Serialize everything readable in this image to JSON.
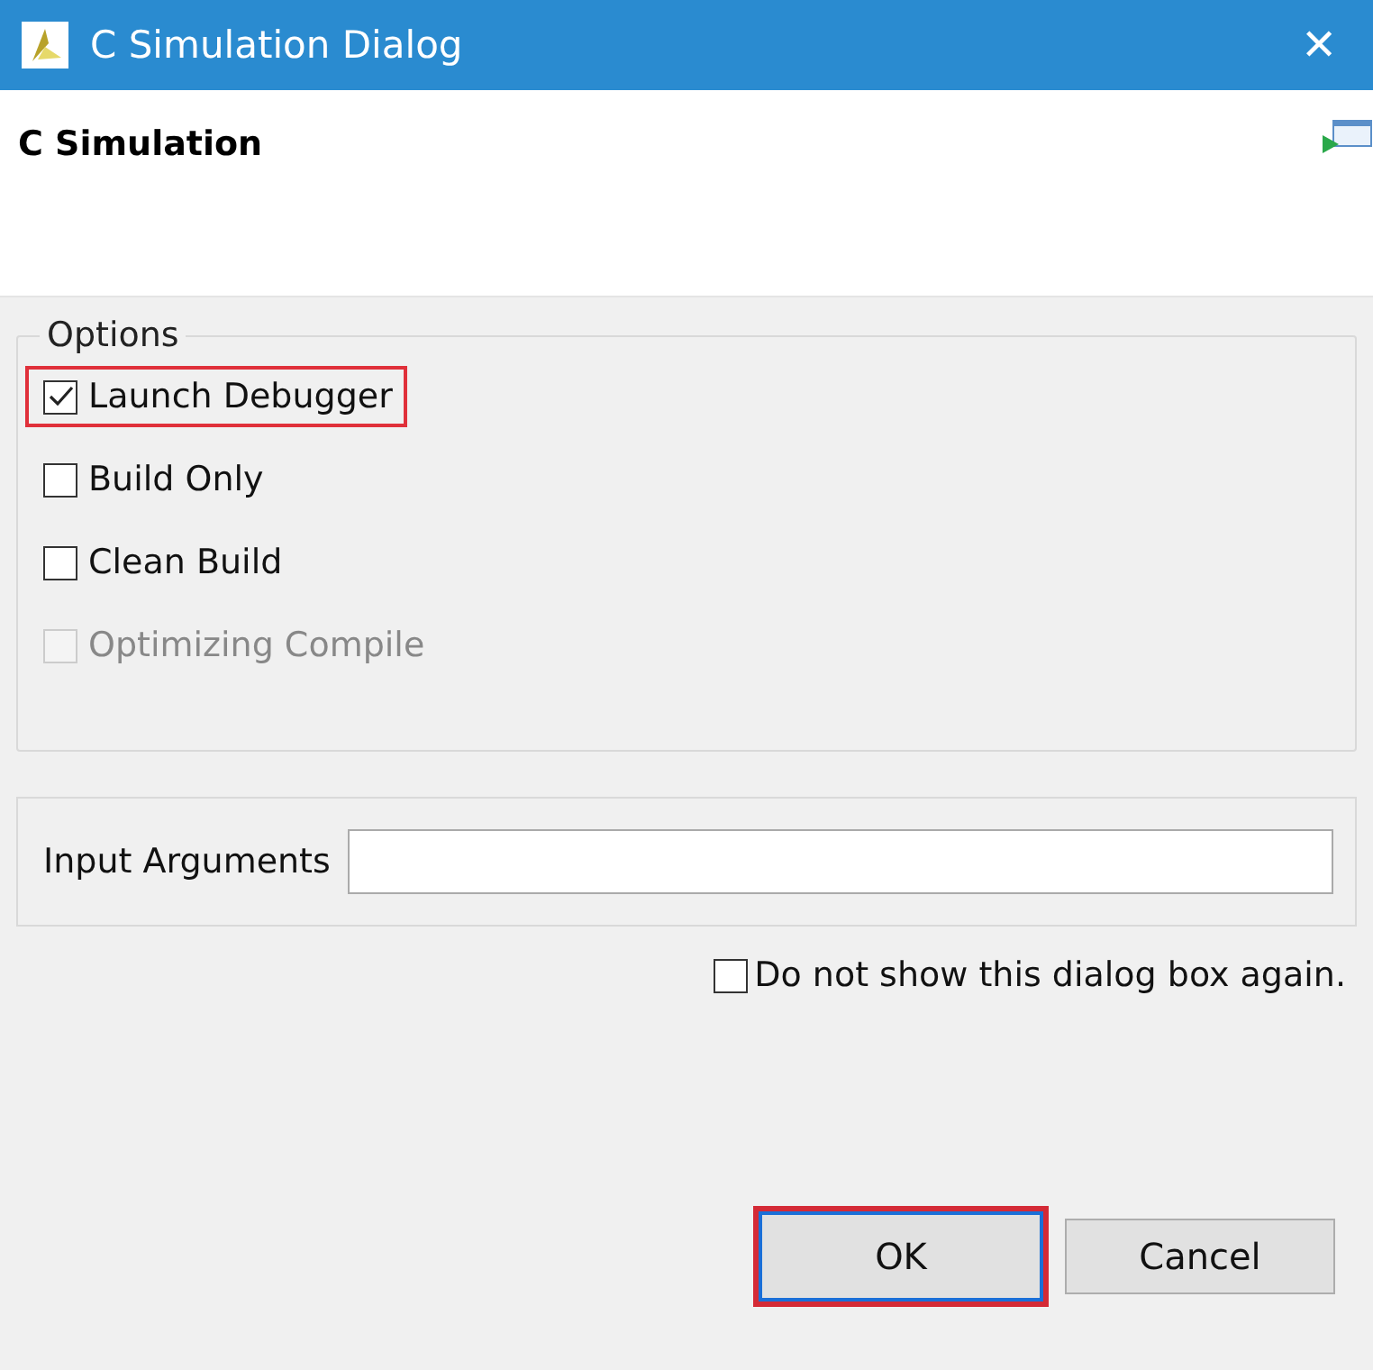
{
  "window": {
    "title": "C Simulation Dialog",
    "close": "✕"
  },
  "header": {
    "title": "C Simulation"
  },
  "options": {
    "legend": "Options",
    "items": [
      {
        "label": "Launch Debugger",
        "checked": true,
        "disabled": false,
        "highlighted": true
      },
      {
        "label": "Build Only",
        "checked": false,
        "disabled": false,
        "highlighted": false
      },
      {
        "label": "Clean Build",
        "checked": false,
        "disabled": false,
        "highlighted": false
      },
      {
        "label": "Optimizing Compile",
        "checked": false,
        "disabled": true,
        "highlighted": false
      }
    ]
  },
  "input_arguments": {
    "label": "Input Arguments"
  },
  "dont_show": {
    "label": "Do not show this dialog box again.",
    "checked": false
  },
  "buttons": [
    {
      "label": "OK",
      "default": true,
      "highlighted": true
    },
    {
      "label": "Cancel",
      "default": false,
      "highlighted": false
    }
  ]
}
